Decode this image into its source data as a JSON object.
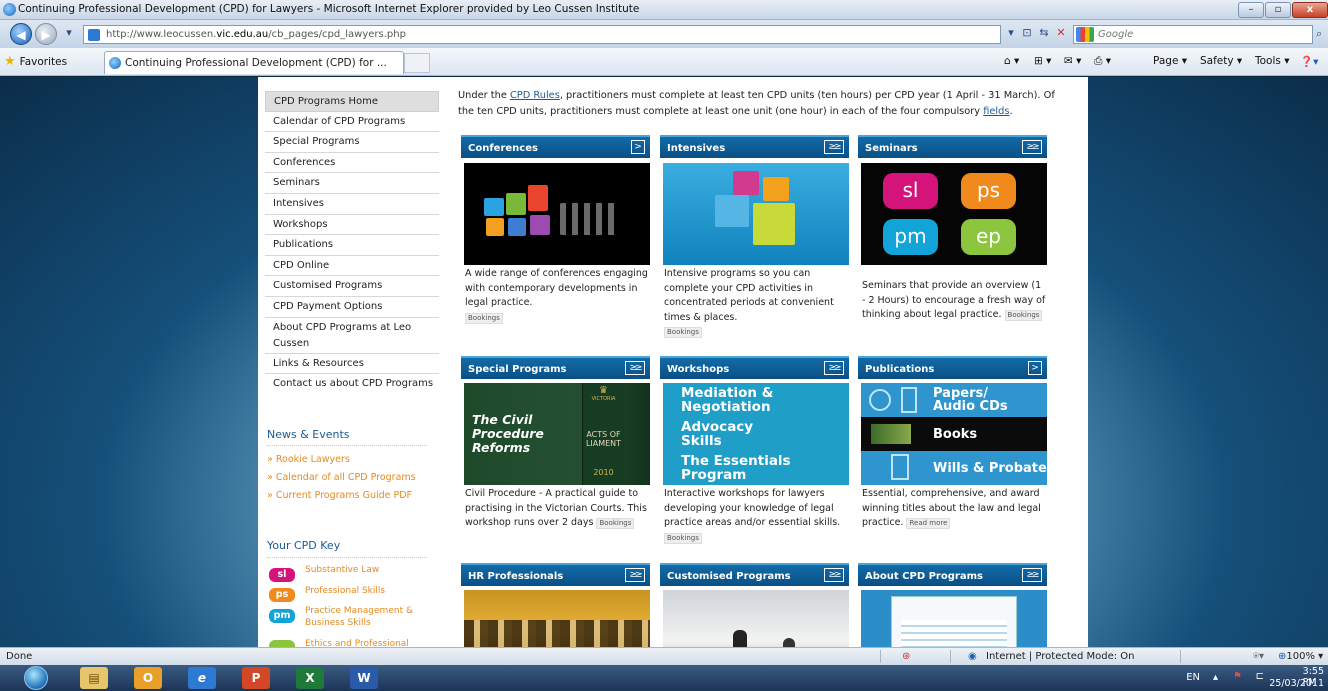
{
  "window": {
    "title": "Continuing Professional Development (CPD) for Lawyers - Microsoft Internet Explorer provided by Leo Cussen Institute",
    "address_prefix": "http://www.leocussen.",
    "address_domain": "vic.edu.au",
    "address_path": "/cb_pages/cpd_lawyers.php",
    "search_placeholder": "Google",
    "favorites_label": "Favorites",
    "tab_title": "Continuing Professional Development (CPD) for ...",
    "commands": [
      "Page ▾",
      "Safety ▾",
      "Tools ▾"
    ]
  },
  "sidebar": {
    "items": [
      "CPD Programs Home",
      "Calendar of CPD Programs",
      "Special Programs",
      "Conferences",
      "Seminars",
      "Intensives",
      "Workshops",
      "Publications",
      "CPD Online",
      "Customised Programs",
      "CPD Payment Options",
      "About CPD Programs at Leo Cussen",
      "Links & Resources",
      "Contact us about CPD Programs"
    ],
    "news_heading": "News & Events",
    "news_links": [
      "» Rookie Lawyers",
      "» Calendar of all CPD Programs",
      "» Current Programs Guide PDF"
    ],
    "key_heading": "Your CPD Key",
    "key_items": [
      {
        "badge": "sl",
        "label": "Substantive Law",
        "color": "#d4147a"
      },
      {
        "badge": "ps",
        "label": "Professional Skills",
        "color": "#f08a1c"
      },
      {
        "badge": "pm",
        "label": "Practice Management & Business Skills",
        "color": "#12a3d9"
      },
      {
        "badge": "",
        "label": "Ethics and Professional",
        "color": "#8cc63f"
      }
    ]
  },
  "intro": {
    "before_rules": "Under the ",
    "rules_link": "CPD Rules",
    "after_rules": ", practitioners must complete at least ten CPD units (ten hours) per CPD year (1 April - 31 March). Of the ten CPD units, practitioners must complete at least one unit (one hour) in each of the four compulsory ",
    "fields_link": "fields",
    "end": "."
  },
  "cards": [
    {
      "title": "Conferences",
      "arrow": ">",
      "desc": "A wide range of conferences engaging with contemporary developments in legal practice.",
      "tag": "Bookings"
    },
    {
      "title": "Intensives",
      "arrow": "≥≥",
      "desc": "Intensive programs so you can complete your CPD activities in concentrated periods at convenient times & places.",
      "tag": "Bookings"
    },
    {
      "title": "Seminars",
      "arrow": "≥≥",
      "desc": "Seminars that provide an overview (1 - 2 Hours) to encourage a fresh way of thinking about legal practice.",
      "tag": "Bookings"
    },
    {
      "title": "Special Programs",
      "arrow": "≥≥",
      "desc": "Civil Procedure - A practical guide to practising in the Victorian Courts. This workshop runs over 2 days",
      "tag": "Bookings"
    },
    {
      "title": "Workshops",
      "arrow": "≥≥",
      "desc": "Interactive workshops for lawyers developing your knowledge of legal practice areas and/or essential skills.",
      "tag": "Bookings"
    },
    {
      "title": "Publications",
      "arrow": ">",
      "desc": "Essential, comprehensive, and award winning titles about the law and legal practice.",
      "tag": "Read more"
    },
    {
      "title": "HR Professionals",
      "arrow": "≥≥",
      "desc": "",
      "tag": ""
    },
    {
      "title": "Customised Programs",
      "arrow": "≥≥",
      "desc": "",
      "tag": ""
    },
    {
      "title": "About CPD Programs",
      "arrow": "≥≥",
      "desc": "",
      "tag": ""
    }
  ],
  "seminar_logos": [
    "sl",
    "ps",
    "pm",
    "ep"
  ],
  "special_book": {
    "line1": "The Civil",
    "line2": "Procedure",
    "line3": "Reforms",
    "spine1": "VICTORIA",
    "spine2": "ACTS OF",
    "spine3": "LIAMENT",
    "year": "2010"
  },
  "workshop_rows": [
    "Mediation &",
    "Negotiation",
    "Advocacy",
    "Skills",
    "The Essentials",
    "Program"
  ],
  "publication_rows": [
    "Papers/",
    "Audio CDs",
    "Books",
    "Wills & Probate"
  ],
  "statusbar": {
    "left": "Done",
    "zone": "Internet | Protected Mode: On",
    "zoom": "100%"
  },
  "taskbar": {
    "lang": "EN",
    "time": "3:55 PM",
    "date": "25/03/2011"
  }
}
